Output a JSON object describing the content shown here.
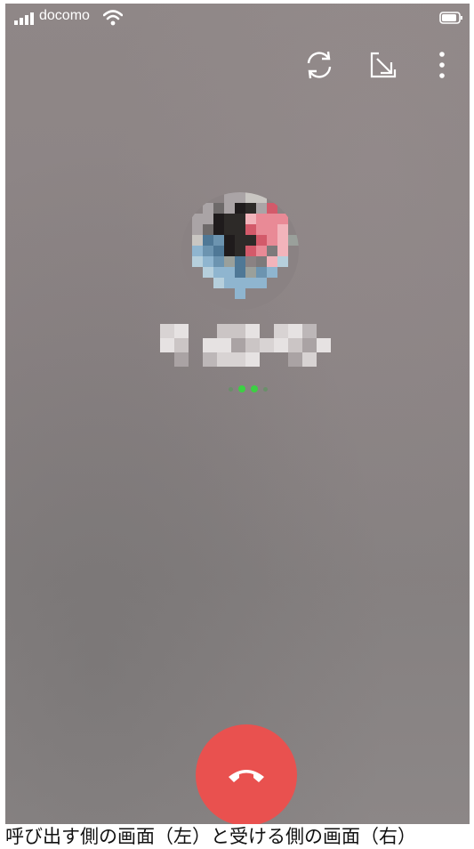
{
  "status_bar": {
    "carrier": "docomo",
    "signal_icon": "signal-bars-icon",
    "wifi_icon": "wifi-icon",
    "battery_icon": "battery-icon"
  },
  "top_controls": {
    "switch_camera_icon": "switch-camera-icon",
    "minimize_icon": "minimize-icon",
    "more_icon": "more-vertical-icon"
  },
  "call": {
    "calling_indicator_colors": [
      "#6a8f6a",
      "#3cd043",
      "#3cd043",
      "#6a8f6a"
    ],
    "end_call_color": "#e9514f",
    "end_call_icon": "hang-up-icon"
  },
  "caption": "呼び出す側の画面（左）と受ける側の画面（右）"
}
